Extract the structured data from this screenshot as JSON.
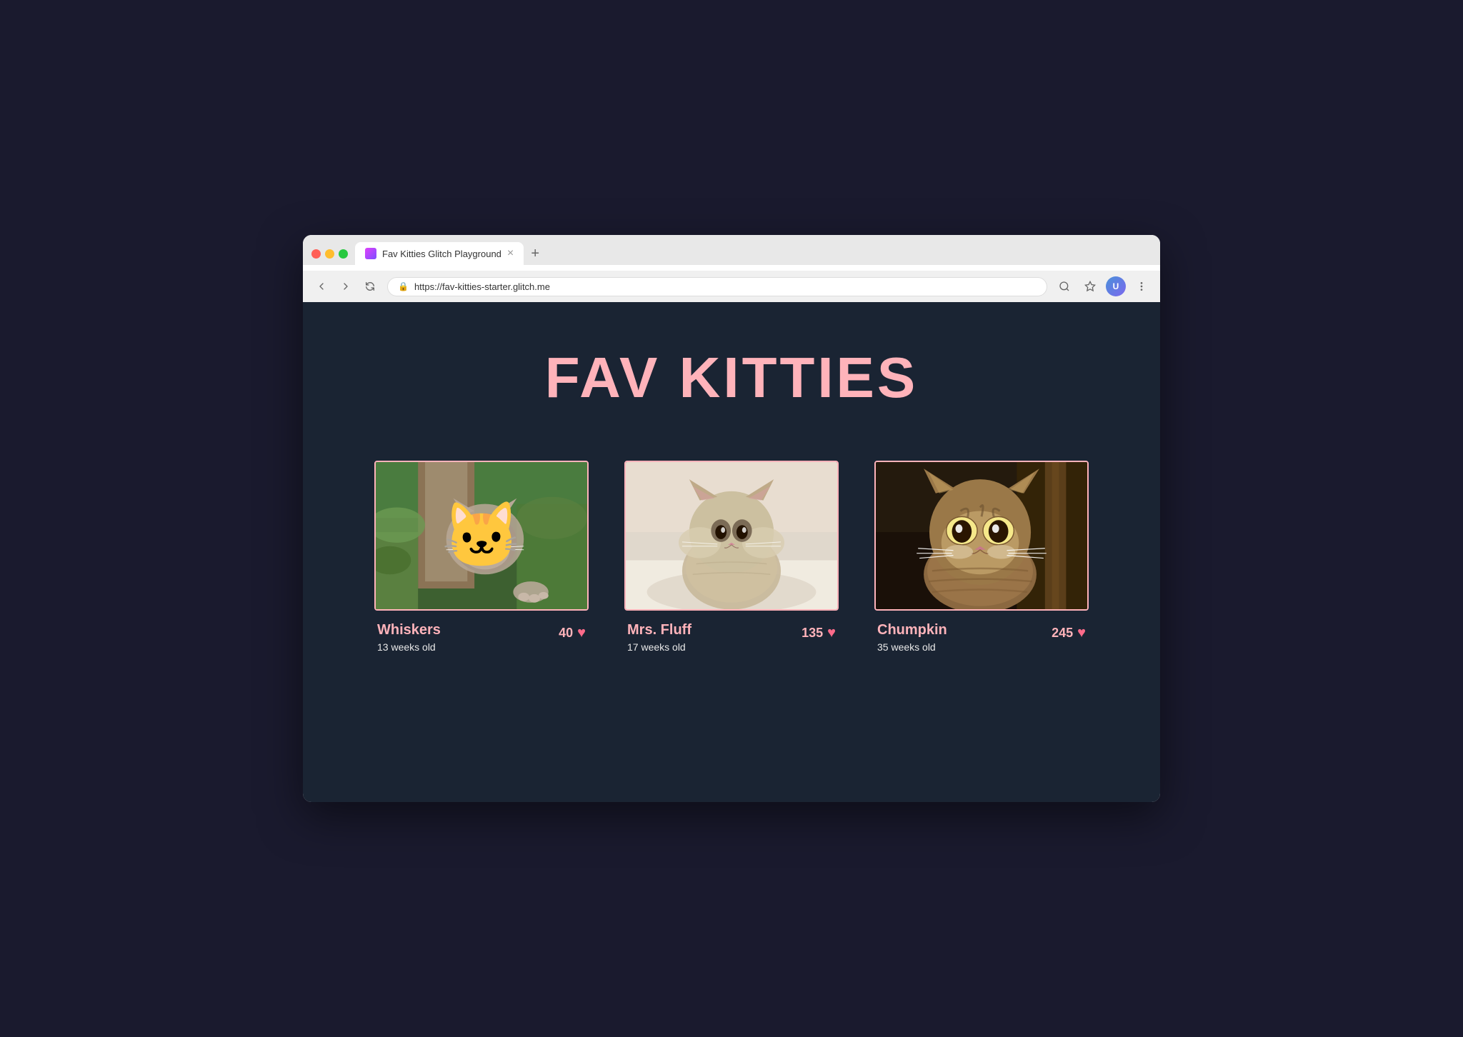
{
  "browser": {
    "tab_favicon_label": "favicon",
    "tab_title": "Fav Kitties Glitch Playground",
    "tab_close_label": "×",
    "tab_new_label": "+",
    "url": "https://fav-kitties-starter.glitch.me",
    "back_label": "back",
    "forward_label": "forward",
    "reload_label": "reload",
    "search_icon_label": "search",
    "star_icon_label": "star",
    "menu_icon_label": "menu"
  },
  "page": {
    "title": "FAV KITTIES",
    "title_color": "#ffb3ba",
    "background_color": "#1a2433"
  },
  "kitties": [
    {
      "id": "whiskers",
      "name": "Whiskers",
      "age": "13 weeks old",
      "likes": "40",
      "image_style": "outdoor-tabby",
      "image_emoji": "🐱"
    },
    {
      "id": "mrs-fluff",
      "name": "Mrs. Fluff",
      "age": "17 weeks old",
      "likes": "135",
      "image_style": "sepia-kitten",
      "image_emoji": "🐱"
    },
    {
      "id": "chumpkin",
      "name": "Chumpkin",
      "age": "35 weeks old",
      "likes": "245",
      "image_style": "tabby-adult",
      "image_emoji": "🐱"
    }
  ],
  "ui": {
    "heart_symbol": "♥",
    "lock_symbol": "🔒"
  }
}
